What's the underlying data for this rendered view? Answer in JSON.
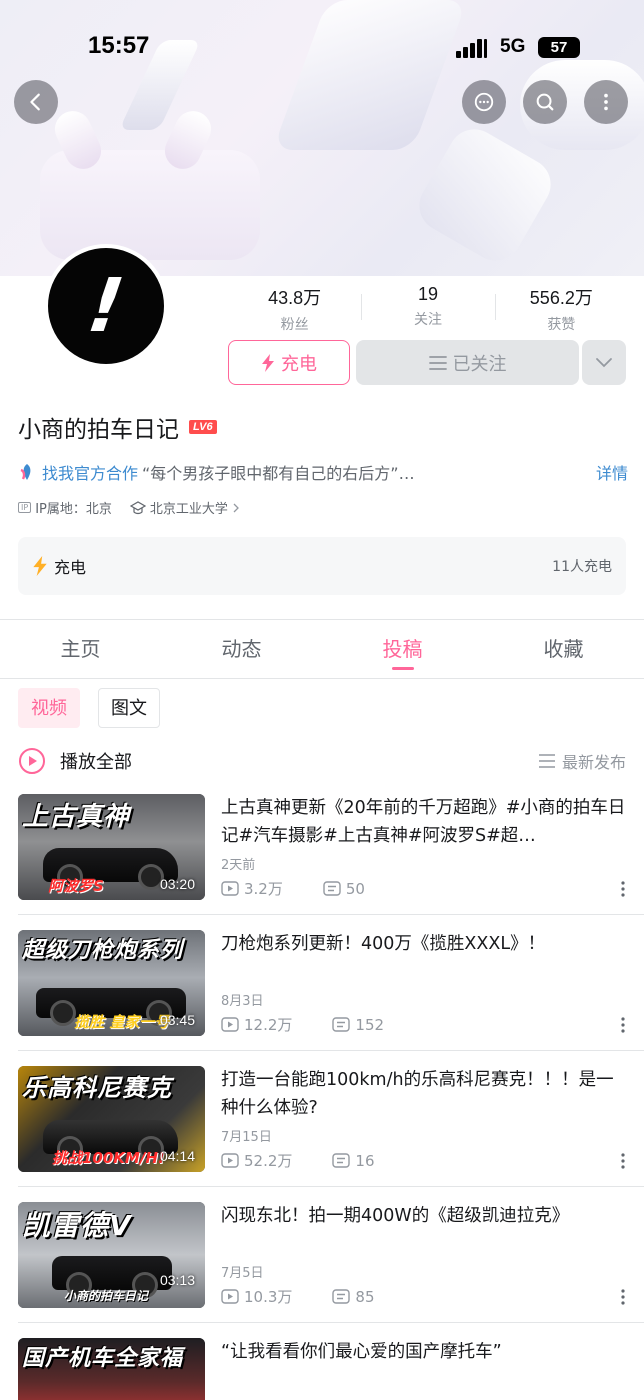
{
  "status_bar": {
    "time": "15:57",
    "network": "5G",
    "battery": "57"
  },
  "profile": {
    "stats": [
      {
        "value": "43.8万",
        "label": "粉丝"
      },
      {
        "value": "19",
        "label": "关注"
      },
      {
        "value": "556.2万",
        "label": "获赞"
      }
    ],
    "charge_button": "充电",
    "follow_button": "已关注",
    "name": "小商的拍车日记",
    "level": "LV6",
    "business_link": "找我官方合作",
    "signature": "“每个男孩子眼中都有自己的右后方”…",
    "detail_link": "详情",
    "ip_badge": "IP",
    "ip": "IP属地：北京",
    "school": "北京工业大学"
  },
  "charge_card": {
    "label": "充电",
    "count": "11人充电"
  },
  "tabs": [
    "主页",
    "动态",
    "投稿",
    "收藏"
  ],
  "active_tab": "投稿",
  "subtabs": [
    "视频",
    "图文"
  ],
  "play_all": "播放全部",
  "sort": "最新发布",
  "videos": [
    {
      "thumb_title": "上古真神",
      "thumb_tag": "阿波罗S",
      "duration": "03:20",
      "title": "上古真神更新《20年前的千万超跑》#小商的拍车日记#汽车摄影#上古真神#阿波罗S#超…",
      "date": "2天前",
      "views": "3.2万",
      "comments": "50"
    },
    {
      "thumb_title": "超级刀枪炮系列",
      "thumb_tag": "揽胜 皇家一号",
      "duration": "03:45",
      "title": "刀枪炮系列更新！400万《揽胜XXXL》！",
      "date": "8月3日",
      "views": "12.2万",
      "comments": "152"
    },
    {
      "thumb_title": "乐高科尼赛克",
      "thumb_tag": "挑战100KM/H!",
      "duration": "04:14",
      "title": "打造一台能跑100km/h的乐高科尼赛克！！！是一种什么体验?",
      "date": "7月15日",
      "views": "52.2万",
      "comments": "16"
    },
    {
      "thumb_title": "凯雷德V",
      "thumb_tag": "小商的拍车日记",
      "duration": "03:13",
      "title": "闪现东北！拍一期400W的《超级凯迪拉克》",
      "date": "7月5日",
      "views": "10.3万",
      "comments": "85"
    },
    {
      "thumb_title": "国产机车全家福",
      "title": "“让我看看你们最心爱的国产摩托车”"
    }
  ],
  "colors": {
    "accent": "#ff6699",
    "link": "#3e8bd0",
    "muted": "#9499a0"
  }
}
